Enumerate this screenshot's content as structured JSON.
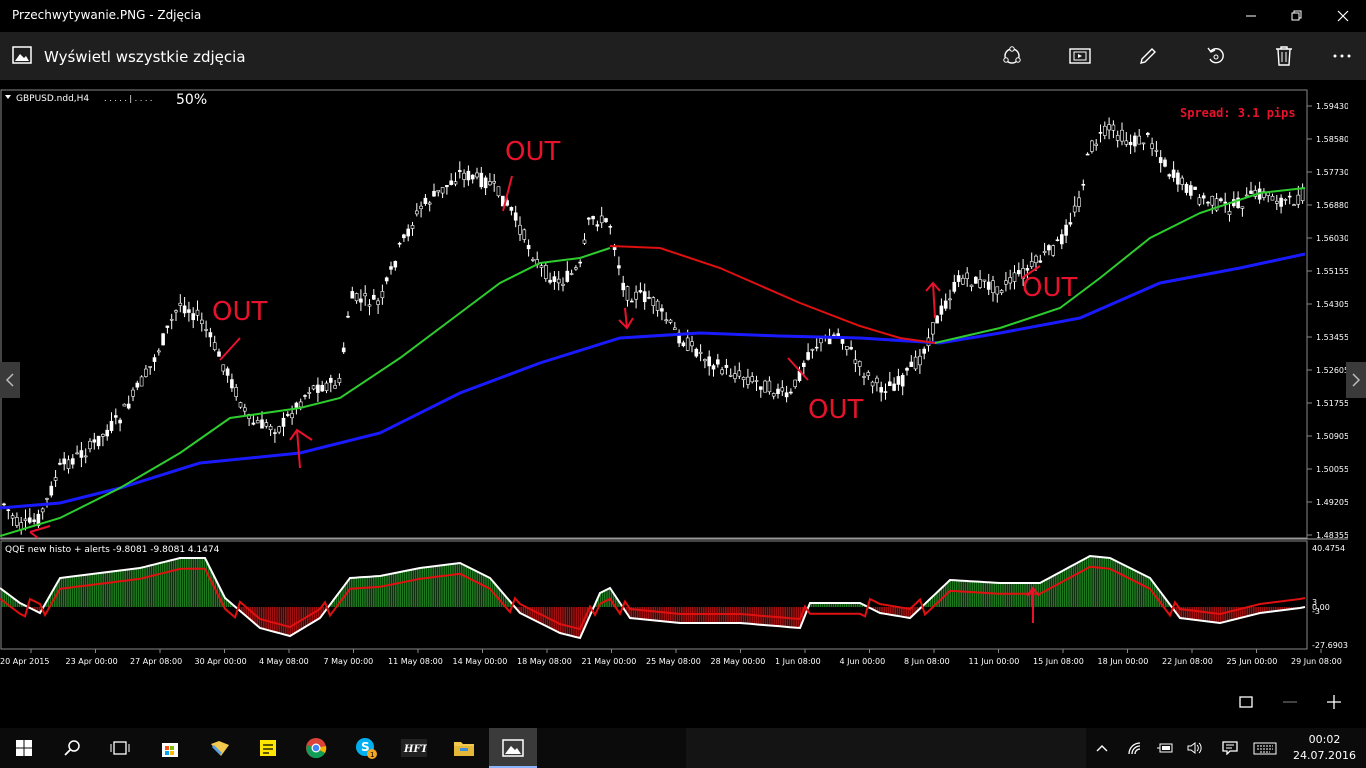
{
  "window": {
    "title": "Przechwytywanie.PNG - Zdjęcia"
  },
  "appbar": {
    "view_all_label": "Wyświetl wszystkie zdjęcia",
    "tools": [
      "share-icon",
      "slideshow-icon",
      "edit-icon",
      "rotate-icon",
      "delete-icon",
      "more-icon"
    ]
  },
  "chart": {
    "symbol_label": "GBPUSD.ndd,H4",
    "zoom_label": "50%",
    "spread_label": "Spread: 3.1 pips",
    "indicator_label": "QQE new histo + alerts -9.8081 -9.8081 4.1474",
    "price_ticks": [
      "1.59430",
      "1.58580",
      "1.57730",
      "1.56880",
      "1.56030",
      "1.55155",
      "1.54305",
      "1.53455",
      "1.52605",
      "1.51755",
      "1.50905",
      "1.50055",
      "1.49205",
      "1.48355"
    ],
    "indicator_ticks": [
      "40.4754",
      "3",
      "0.00",
      "-3",
      "-27.6903"
    ],
    "time_ticks": [
      "20 Apr 2015",
      "23 Apr 00:00",
      "27 Apr 08:00",
      "30 Apr 00:00",
      "4 May 08:00",
      "7 May 00:00",
      "11 May 08:00",
      "14 May 00:00",
      "18 May 08:00",
      "21 May 00:00",
      "25 May 08:00",
      "28 May 00:00",
      "1 Jun 08:00",
      "4 Jun 00:00",
      "8 Jun 08:00",
      "11 Jun 00:00",
      "15 Jun 08:00",
      "18 Jun 00:00",
      "22 Jun 08:00",
      "25 Jun 00:00",
      "29 Jun 08:00"
    ],
    "annotations": [
      "OUT",
      "OUT",
      "OUT",
      "OUT"
    ],
    "colors": {
      "fast_ma": "#2ecc2e",
      "slow_ma": "#1a1aff",
      "mid_ma": "#e01010",
      "bull": "#1f7a1f",
      "bear": "#a01010",
      "annotation": "#e8122c"
    }
  },
  "taskbar": {
    "clock_time": "00:02",
    "clock_date": "24.07.2016",
    "app_icons": [
      "start-icon",
      "search-icon",
      "task-view-icon",
      "store-icon",
      "explorer-notes-icon",
      "sticky-notes-icon",
      "chrome-icon",
      "skype-icon",
      "hft-icon",
      "file-explorer-icon",
      "photos-icon"
    ],
    "skype_badge": "1"
  }
}
